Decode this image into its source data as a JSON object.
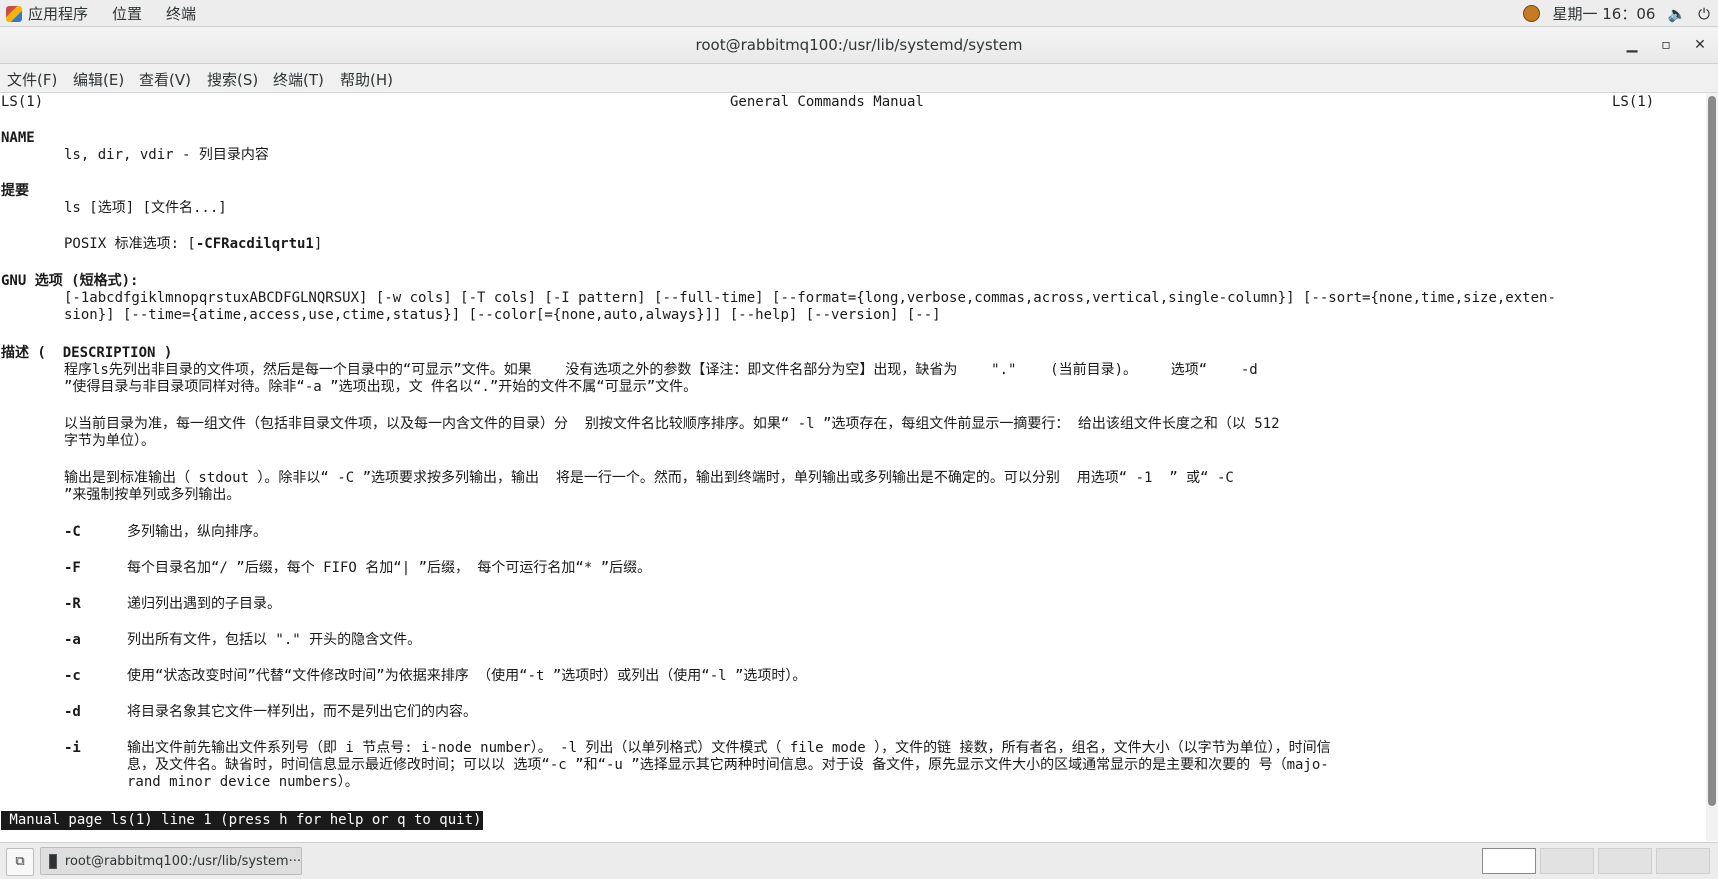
{
  "top_panel": {
    "applications": "应用程序",
    "places": "位置",
    "terminal": "终端",
    "clock": "星期一 16：06",
    "icons": [
      "applications-icon",
      "user-status-icon",
      "volume-icon",
      "power-icon"
    ]
  },
  "window": {
    "title": "root@rabbitmq100:/usr/lib/systemd/system",
    "buttons": [
      "minimize",
      "maximize",
      "close"
    ]
  },
  "menubar": [
    "文件(F)",
    "编辑(E)",
    "查看(V)",
    "搜索(S)",
    "终端(T)",
    "帮助(H)"
  ],
  "man": {
    "header_left": "LS(1)",
    "header_center": "General Commands Manual",
    "header_right": "LS(1)",
    "name_heading": "NAME",
    "name_text": "ls, dir, vdir - 列目录内容",
    "synopsis_heading": "提要",
    "synopsis_line": "ls [选项] [文件名...]",
    "posix_prefix": "POSIX 标准选项: [",
    "posix_opts": "-CFRacdilqrtu1",
    "posix_suffix": "]",
    "gnu_heading": "GNU 选项 (短格式):",
    "gnu_line1": "[-1abcdfgiklmnopqrstuxABCDFGLNQRSUX] [-w cols] [-T cols] [-I pattern] [--full-time] [--format={long,verbose,commas,across,vertical,single-column}] [--sort={none,time,size,exten-",
    "gnu_line2": "sion}] [--time={atime,access,use,ctime,status}] [--color[={none,auto,always}]] [--help] [--version] [--]",
    "desc_heading_prefix": "描述 (",
    "desc_heading_en": "DESCRIPTION",
    "desc_heading_suffix": ")",
    "desc_p1_l1": "程序ls先列出非目录的文件项，然后是每一个目录中的“可显示”文件。如果    没有选项之外的参数【译注：即文件名部分为空】出现，缺省为    \".\"    (当前目录)。    选项“    -d",
    "desc_p1_l2": "”使得目录与非目录项同样对待。除非“-a ”选项出现，文 件名以“.”开始的文件不属“可显示”文件。",
    "desc_p2_l1": "以当前目录为准，每一组文件（包括非目录文件项，以及每一内含文件的目录）分  别按文件名比较顺序排序。如果“ -l ”选项存在，每组文件前显示一摘要行： 给出该组文件长度之和（以 512",
    "desc_p2_l2": "字节为单位）。",
    "desc_p3_l1": "输出是到标准输出（ stdout ）。除非以“ -C ”选项要求按多列输出，输出  将是一行一个。然而，输出到终端时，单列输出或多列输出是不确定的。可以分别  用选项“ -1  ” 或“ -C",
    "desc_p3_l2": "”来强制按单列或多列输出。",
    "options": [
      {
        "flag": "-C",
        "text": "多列输出，纵向排序。"
      },
      {
        "flag": "-F",
        "text": "每个目录名加“/ ”后缀，每个 FIFO 名加“| ”后缀， 每个可运行名加“* ”后缀。"
      },
      {
        "flag": "-R",
        "text": "递归列出遇到的子目录。"
      },
      {
        "flag": "-a",
        "text": "列出所有文件，包括以 \".\" 开头的隐含文件。"
      },
      {
        "flag": "-c",
        "text": "使用“状态改变时间”代替“文件修改时间”为依据来排序 （使用“-t ”选项时）或列出（使用“-l ”选项时）。"
      },
      {
        "flag": "-d",
        "text": "将目录名象其它文件一样列出，而不是列出它们的内容。"
      },
      {
        "flag": "-i",
        "text": "输出文件前先输出文件系列号（即 i 节点号: i-node number）。 -l 列出（以单列格式）文件模式（ file mode ），文件的链 接数，所有者名，组名，文件大小（以字节为单位），时间信"
      }
    ],
    "opt_i_l2": "息，及文件名。缺省时，时间信息显示最近修改时间；可以以 选项“-c ”和“-u ”选择显示其它两种时间信息。对于设 备文件，原先显示文件大小的区域通常显示的是主要和次要的 号（majo-",
    "opt_i_l3": "rand minor device numbers）。",
    "status_line": " Manual page ls(1) line 1 (press h for help or q to quit)"
  },
  "taskbar": {
    "task_title": "root@rabbitmq100:/usr/lib/system···",
    "workspaces": 4,
    "active_workspace": 1
  }
}
